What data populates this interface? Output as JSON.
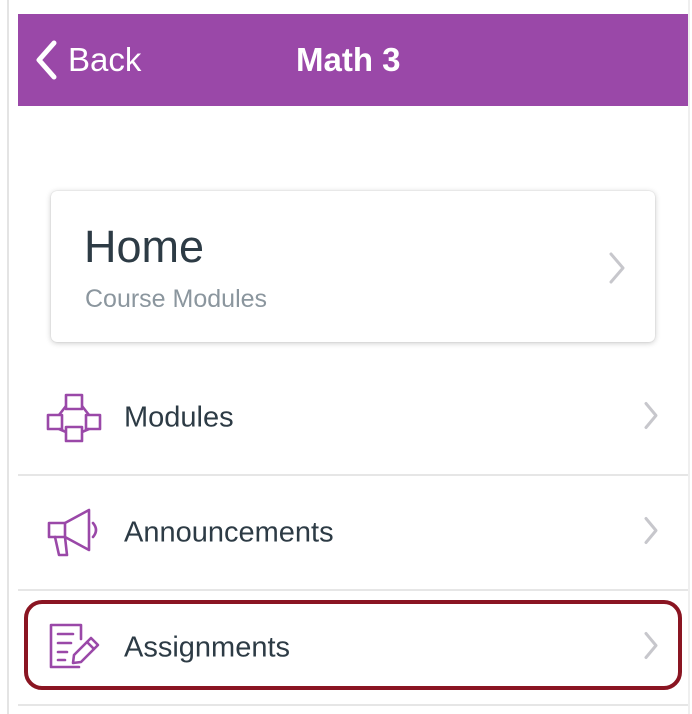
{
  "header": {
    "back_label": "Back",
    "title": "Math 3",
    "background_color": "#9a48a8"
  },
  "home_card": {
    "title": "Home",
    "subtitle": "Course Modules"
  },
  "nav_items": [
    {
      "label": "Modules",
      "icon": "modules-icon"
    },
    {
      "label": "Announcements",
      "icon": "megaphone-icon"
    },
    {
      "label": "Assignments",
      "icon": "assignments-icon",
      "highlighted": true
    }
  ],
  "colors": {
    "accent": "#9a48a8",
    "text": "#2d3b45",
    "subtext": "#8b969e",
    "chevron": "#c7c7cc",
    "highlight_border": "#8a1522"
  }
}
